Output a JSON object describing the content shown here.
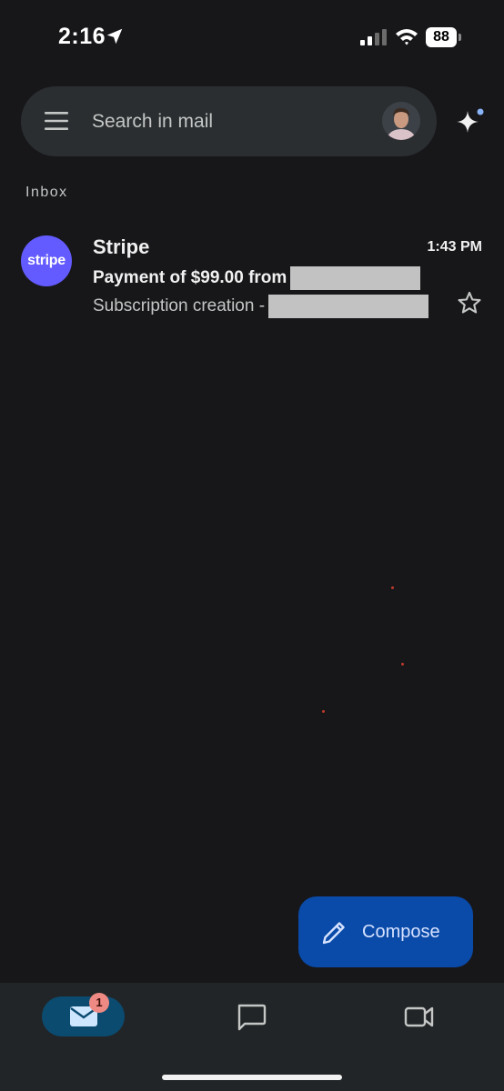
{
  "status_bar": {
    "time": "2:16",
    "battery": "88"
  },
  "search": {
    "placeholder": "Search in mail"
  },
  "section": {
    "label": "Inbox"
  },
  "emails": [
    {
      "avatar_text": "stripe",
      "sender": "Stripe",
      "time": "1:43 PM",
      "subject": "Payment of $99.00 from",
      "snippet": "Subscription creation -",
      "starred": false
    }
  ],
  "compose": {
    "label": "Compose"
  },
  "bottom_nav": {
    "mail_badge": "1"
  },
  "colors": {
    "background": "#17171a",
    "stripe_brand": "#635bff",
    "compose_bg": "#0a4aa8",
    "badge": "#ee8a83"
  }
}
